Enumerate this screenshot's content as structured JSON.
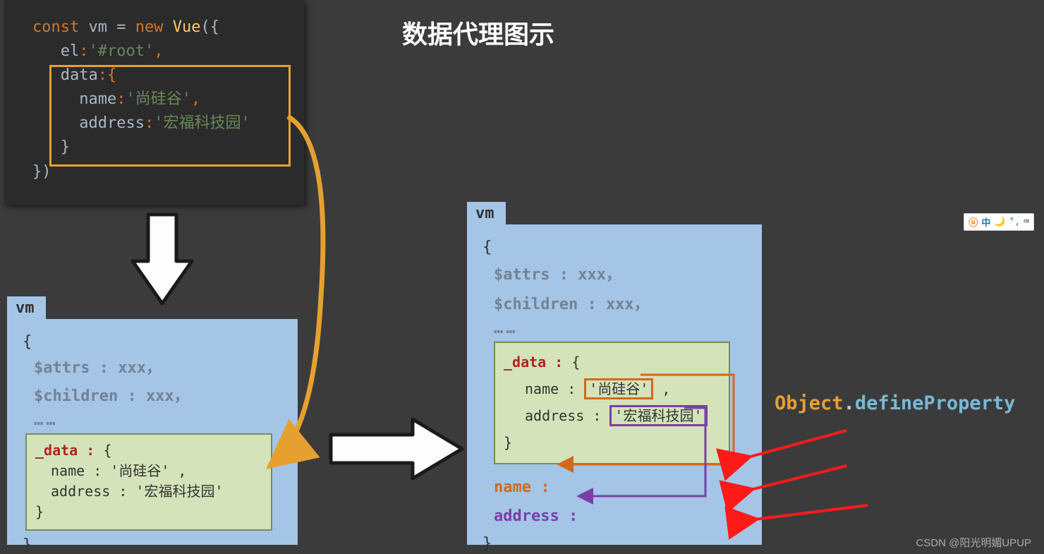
{
  "title": "数据代理图示",
  "code": {
    "l1_const": "const ",
    "l1_vm": "vm ",
    "l1_eq": "= ",
    "l1_new": "new ",
    "l1_vue": "Vue",
    "l1_paren": "({",
    "l2_el": "el",
    "l2_colon": ":",
    "l2_root": "'#root'",
    "l2_comma": ",",
    "l3_data": "data",
    "l3_brace": ":{",
    "l4_name": "name",
    "l4_val": "'尚硅谷'",
    "l5_addr": "address",
    "l5_val": "'宏福科技园'",
    "l6_close": "}",
    "l7_close": "})"
  },
  "vm_tab": "vm",
  "vm": {
    "open": "{",
    "close": "}",
    "attrs": "$attrs : xxx，",
    "children": "$children : xxx，",
    "ellipsis": "……"
  },
  "data_left": {
    "key": "_data : ",
    "open": "{",
    "name_line": "name : '尚硅谷' ,",
    "addr_line": "address : '宏福科技园'",
    "close": "}"
  },
  "data_right": {
    "key": "_data : ",
    "open": "{",
    "name_label": "name : ",
    "name_val": "'尚硅谷'",
    "name_comma": " ,",
    "addr_label": "address : ",
    "addr_val": "'宏福科技园'",
    "close": "}",
    "proxy_name": "name : ",
    "proxy_addr": "address : "
  },
  "define_property": {
    "obj": "Object",
    "dot": ".",
    "meth": "defineProperty"
  },
  "ime": {
    "u": "ⓤ",
    "cn": "中",
    "moon": "🌙",
    "punct": "°,",
    "kb": "⌨"
  },
  "watermark": "CSDN @阳光明媚UPUP"
}
